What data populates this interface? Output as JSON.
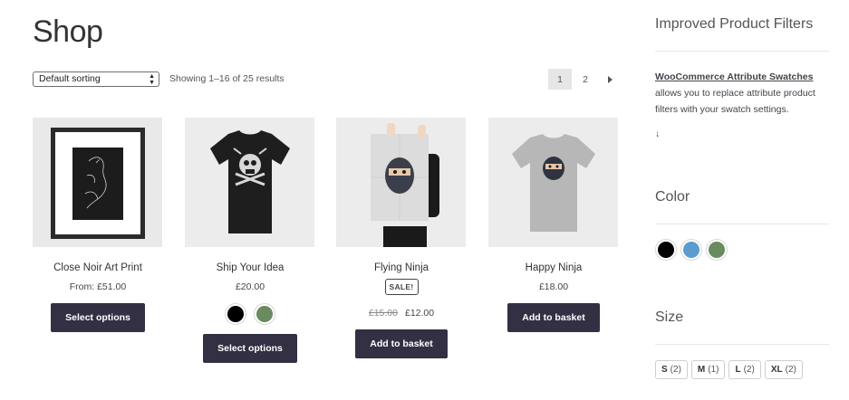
{
  "page": {
    "title": "Shop"
  },
  "toolbar": {
    "sort_value": "Default sorting",
    "result_count": "Showing 1–16 of 25 results",
    "pages": [
      "1",
      "2"
    ],
    "current_page": "1"
  },
  "products": [
    {
      "name": "Close Noir Art Print",
      "price": "From: £51.00",
      "button": "Select options"
    },
    {
      "name": "Ship Your Idea",
      "price": "£20.00",
      "button": "Select options",
      "swatches": [
        "#000000",
        "#6a8a5f"
      ]
    },
    {
      "name": "Flying Ninja",
      "badge": "SALE!",
      "old_price": "£15.00",
      "price": "£12.00",
      "button": "Add to basket"
    },
    {
      "name": "Happy Ninja",
      "price": "£18.00",
      "button": "Add to basket"
    }
  ],
  "sidebar": {
    "filters_title": "Improved Product Filters",
    "link_text": "WooCommerce Attribute Swatches",
    "description": "allows you to replace attribute product filters with your swatch settings.",
    "arrow": "↓",
    "color_title": "Color",
    "colors": [
      "#000000",
      "#5a9bd0",
      "#6a8a5f"
    ],
    "size_title": "Size",
    "sizes": [
      {
        "label": "S",
        "count": "(2)"
      },
      {
        "label": "M",
        "count": "(1)"
      },
      {
        "label": "L",
        "count": "(2)"
      },
      {
        "label": "XL",
        "count": "(2)"
      }
    ]
  },
  "colors": {
    "button_bg": "#333044",
    "text": "#43454b",
    "image_bg": "#ececec"
  }
}
